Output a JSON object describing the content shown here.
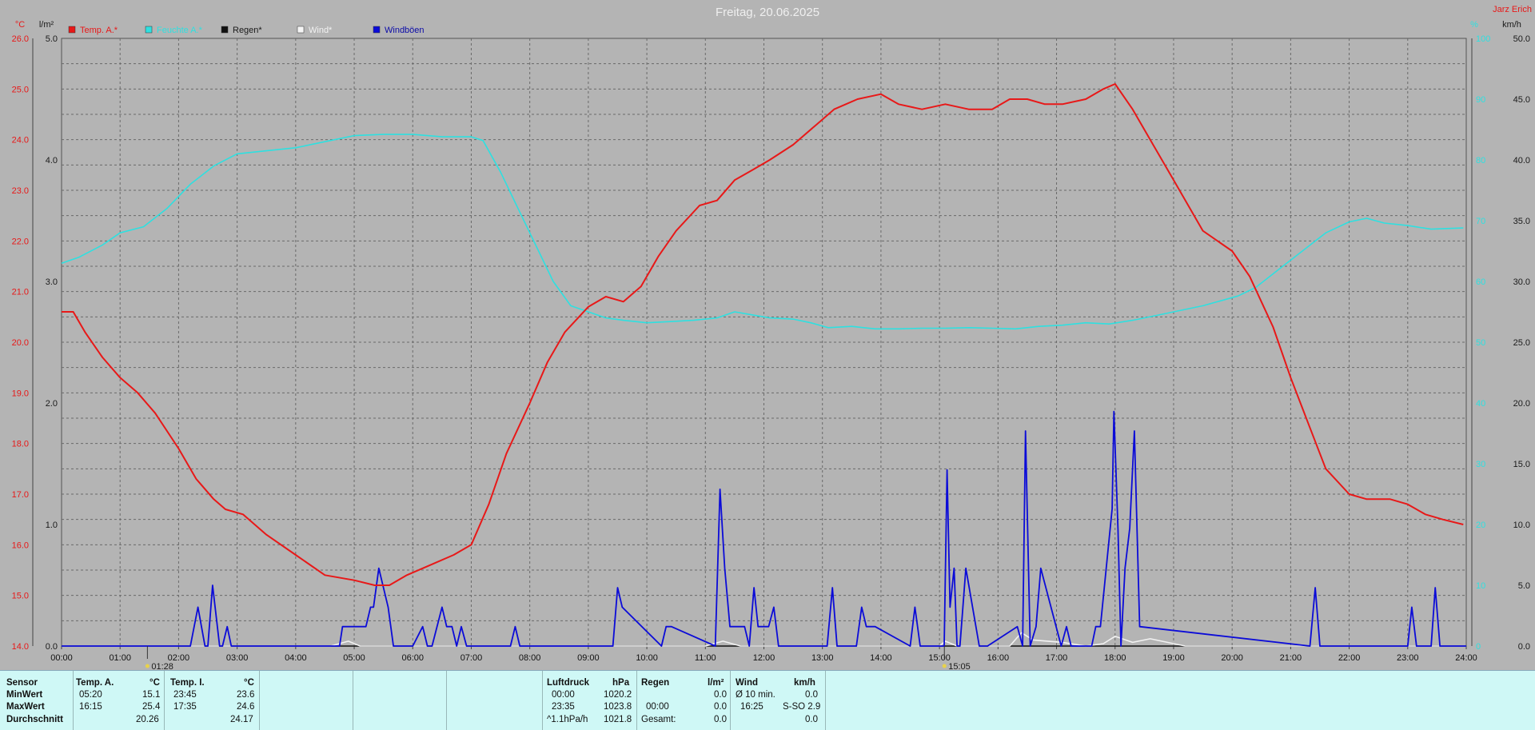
{
  "title": "Freitag, 20.06.2025",
  "station": "Jarz Erich",
  "units": {
    "temp": "°C",
    "rain": "l/m²",
    "hum": "%",
    "wind": "km/h"
  },
  "legend": [
    {
      "label": "Temp. A.*",
      "color": "#e81818"
    },
    {
      "label": "Feuchte A.*",
      "color": "#2ee0e0"
    },
    {
      "label": "Regen*",
      "color": "#111111"
    },
    {
      "label": "Wind*",
      "color": "#f5f5f5"
    },
    {
      "label": "Windböen",
      "color": "#0b0bd8"
    }
  ],
  "markers": [
    {
      "time": "01:28",
      "label": "01:28"
    },
    {
      "time": "15:05",
      "label": "15:05"
    }
  ],
  "chart_data": {
    "type": "line",
    "x_ticks": [
      "00:00",
      "01:00",
      "02:00",
      "03:00",
      "04:00",
      "05:00",
      "06:00",
      "07:00",
      "08:00",
      "09:00",
      "10:00",
      "11:00",
      "12:00",
      "13:00",
      "14:00",
      "15:00",
      "16:00",
      "17:00",
      "18:00",
      "19:00",
      "20:00",
      "21:00",
      "22:00",
      "23:00",
      "24:00"
    ],
    "axes": {
      "temp": {
        "ylim": [
          14.0,
          26.0
        ],
        "ticks": [
          "26.0",
          "25.0",
          "24.0",
          "23.0",
          "22.0",
          "21.0",
          "20.0",
          "19.0",
          "18.0",
          "17.0",
          "16.0",
          "15.0",
          "14.0"
        ]
      },
      "rain": {
        "ylim": [
          0.0,
          5.0
        ],
        "ticks": [
          "5.0",
          "4.0",
          "3.0",
          "2.0",
          "1.0",
          "0.0"
        ]
      },
      "hum": {
        "ylim": [
          0,
          100
        ],
        "ticks": [
          "100",
          "90",
          "80",
          "70",
          "60",
          "50",
          "40",
          "30",
          "20",
          "10",
          "0"
        ]
      },
      "wind": {
        "ylim": [
          0.0,
          50.0
        ],
        "ticks": [
          "50.0",
          "45.0",
          "40.0",
          "35.0",
          "30.0",
          "25.0",
          "20.0",
          "15.0",
          "10.0",
          "5.0",
          "0.0"
        ]
      }
    },
    "series": [
      {
        "name": "Temp. A.*",
        "axis": "temp",
        "color": "#e81818",
        "x": [
          0,
          0.2,
          0.4,
          0.7,
          1.0,
          1.3,
          1.6,
          2.0,
          2.3,
          2.6,
          2.8,
          3.1,
          3.5,
          4.0,
          4.5,
          5.0,
          5.35,
          5.6,
          5.9,
          6.3,
          6.7,
          7.0,
          7.3,
          7.6,
          8.0,
          8.3,
          8.6,
          9.0,
          9.3,
          9.6,
          9.9,
          10.2,
          10.5,
          10.9,
          11.2,
          11.5,
          11.8,
          12.1,
          12.5,
          12.9,
          13.2,
          13.6,
          14.0,
          14.3,
          14.7,
          15.1,
          15.5,
          15.9,
          16.2,
          16.5,
          16.8,
          17.1,
          17.5,
          17.8,
          18.0,
          18.3,
          18.6,
          19.0,
          19.5,
          20.0,
          20.3,
          20.7,
          21.0,
          21.3,
          21.6,
          22.0,
          22.3,
          22.7,
          23.0,
          23.3,
          23.6,
          23.95
        ],
        "y": [
          20.6,
          20.6,
          20.2,
          19.7,
          19.3,
          19.0,
          18.6,
          17.9,
          17.3,
          16.9,
          16.7,
          16.6,
          16.2,
          15.8,
          15.4,
          15.3,
          15.2,
          15.2,
          15.4,
          15.6,
          15.8,
          16.0,
          16.8,
          17.8,
          18.8,
          19.6,
          20.2,
          20.7,
          20.9,
          20.8,
          21.1,
          21.7,
          22.2,
          22.7,
          22.8,
          23.2,
          23.4,
          23.6,
          23.9,
          24.3,
          24.6,
          24.8,
          24.9,
          24.7,
          24.6,
          24.7,
          24.6,
          24.6,
          24.8,
          24.8,
          24.7,
          24.7,
          24.8,
          25.0,
          25.1,
          24.6,
          24.0,
          23.2,
          22.2,
          21.8,
          21.3,
          20.3,
          19.3,
          18.4,
          17.5,
          17.0,
          16.9,
          16.9,
          16.8,
          16.6,
          16.5,
          16.4
        ]
      },
      {
        "name": "Feuchte A.*",
        "axis": "hum",
        "color": "#2ee0e0",
        "x": [
          0,
          0.3,
          0.7,
          1.0,
          1.4,
          1.8,
          2.2,
          2.6,
          3.0,
          3.5,
          4.0,
          4.5,
          5.0,
          5.5,
          6.0,
          6.5,
          7.0,
          7.2,
          7.5,
          7.8,
          8.1,
          8.4,
          8.7,
          9.0,
          9.3,
          9.6,
          10.0,
          10.4,
          10.8,
          11.2,
          11.5,
          11.8,
          12.1,
          12.5,
          12.8,
          13.1,
          13.5,
          13.9,
          14.3,
          14.7,
          15.1,
          15.5,
          15.9,
          16.3,
          16.7,
          17.1,
          17.5,
          17.9,
          18.3,
          18.7,
          19.1,
          19.5,
          19.8,
          20.1,
          20.4,
          20.8,
          21.2,
          21.6,
          22.0,
          22.3,
          22.6,
          23.0,
          23.4,
          23.95
        ],
        "y": [
          63,
          64,
          66,
          68,
          69,
          72,
          76,
          79,
          81,
          81.5,
          82,
          83,
          84,
          84.2,
          84.2,
          83.8,
          83.8,
          83.2,
          78,
          72,
          66,
          60,
          56,
          55,
          54,
          53.6,
          53.2,
          53.4,
          53.6,
          54,
          55,
          54.5,
          54,
          53.8,
          53.2,
          52.4,
          52.6,
          52.2,
          52.2,
          52.3,
          52.3,
          52.4,
          52.3,
          52.2,
          52.6,
          52.8,
          53.2,
          53,
          53.6,
          54.4,
          55.2,
          56,
          56.8,
          57.6,
          59,
          62,
          65,
          68,
          69.8,
          70.4,
          69.6,
          69.2,
          68.6,
          68.8
        ]
      },
      {
        "name": "Wind*",
        "axis": "wind",
        "color": "#f2f2f2",
        "x": [
          0,
          4.6,
          4.9,
          5.1,
          11.0,
          11.3,
          11.6,
          15.0,
          15.1,
          15.3,
          16.2,
          16.4,
          16.6,
          17.1,
          17.5,
          17.8,
          18.0,
          18.3,
          18.6,
          19.0,
          19.2,
          24.0
        ],
        "y": [
          0,
          0,
          0.4,
          0,
          0,
          0.4,
          0,
          0,
          0.4,
          0,
          0,
          1.1,
          0.5,
          0.3,
          0,
          0.2,
          0.8,
          0.3,
          0.6,
          0.2,
          0,
          0
        ]
      },
      {
        "name": "Windböen",
        "axis": "wind",
        "color": "#0b0bd8",
        "x": [
          0,
          2.2,
          2.33,
          2.45,
          2.5,
          2.58,
          2.7,
          2.75,
          2.83,
          2.9,
          3.0,
          4.75,
          4.8,
          5.2,
          5.28,
          5.33,
          5.42,
          5.58,
          5.67,
          6.0,
          6.17,
          6.25,
          6.33,
          6.5,
          6.58,
          6.67,
          6.75,
          6.83,
          6.92,
          7.0,
          7.08,
          7.67,
          7.75,
          7.83,
          9.42,
          9.5,
          9.58,
          10.25,
          10.33,
          10.42,
          11.17,
          11.25,
          11.33,
          11.42,
          11.67,
          11.75,
          11.83,
          11.9,
          12.08,
          12.17,
          12.25,
          12.33,
          12.42,
          13.08,
          13.17,
          13.25,
          13.58,
          13.67,
          13.75,
          13.9,
          14.5,
          14.58,
          14.67,
          15.08,
          15.13,
          15.18,
          15.25,
          15.3,
          15.35,
          15.45,
          15.68,
          15.75,
          15.82,
          16.33,
          16.42,
          16.47,
          16.55,
          16.65,
          16.73,
          17.08,
          17.17,
          17.25,
          17.6,
          17.67,
          17.75,
          17.95,
          17.98,
          18.05,
          18.1,
          18.17,
          18.25,
          18.33,
          18.42,
          21.33,
          21.42,
          21.5,
          23.0,
          23.07,
          23.15,
          23.4,
          23.47,
          23.55,
          24.0
        ],
        "y": [
          0,
          0,
          3.2,
          0,
          0,
          5,
          0,
          0,
          1.6,
          0,
          0,
          0,
          1.6,
          1.6,
          3.2,
          3.2,
          6.4,
          3.2,
          0,
          0,
          1.6,
          0,
          0,
          3.2,
          1.6,
          1.6,
          0,
          1.6,
          0,
          0,
          0,
          0,
          1.6,
          0,
          0,
          4.8,
          3.2,
          0,
          1.6,
          1.6,
          0,
          12.9,
          6.4,
          1.6,
          1.6,
          0,
          4.8,
          1.6,
          1.6,
          3.2,
          0,
          0,
          0,
          0,
          4.8,
          0,
          0,
          3.2,
          1.6,
          1.6,
          0,
          3.2,
          0,
          0,
          14.5,
          3.2,
          6.4,
          0,
          0,
          6.4,
          0,
          0,
          0,
          1.6,
          0,
          17.7,
          0,
          1.6,
          6.4,
          0,
          1.6,
          0,
          0,
          1.6,
          1.6,
          11.3,
          19.3,
          9.6,
          0,
          6.4,
          9.7,
          17.7,
          1.6,
          0,
          4.8,
          0,
          0,
          3.2,
          0,
          0,
          4.8,
          0,
          0
        ]
      },
      {
        "name": "Regen*",
        "axis": "rain",
        "color": "#111111",
        "x": [
          0,
          24
        ],
        "y": [
          0,
          0
        ]
      }
    ]
  },
  "stats": {
    "sensor_header": "Sensor",
    "row_labels": [
      "MinWert",
      "MaxWert",
      "Durchschnitt"
    ],
    "temp_a": {
      "header": "Temp. A.",
      "unit": "°C",
      "min_time": "05:20",
      "min": "15.1",
      "max_time": "16:15",
      "max": "25.4",
      "avg": "20.26"
    },
    "temp_i": {
      "header": "Temp. I.",
      "unit": "°C",
      "min_time": "23:45",
      "min": "23.6",
      "max_time": "17:35",
      "max": "24.6",
      "avg": "24.17"
    },
    "luftdruck": {
      "header": "Luftdruck",
      "unit": "hPa",
      "min_time": "00:00",
      "min": "1020.2",
      "max_time": "23:35",
      "max": "1023.8",
      "trend_label": "^1.1hPa/h",
      "avg": "1021.8"
    },
    "regen": {
      "header": "Regen",
      "unit": "l/m²",
      "r1_val": "0.0",
      "r2_time": "00:00",
      "r2_val": "0.0",
      "total_label": "Gesamt:",
      "total": "0.0"
    },
    "wind": {
      "header": "Wind",
      "unit": "km/h",
      "r1_label": "Ø 10 min.",
      "r1_val": "0.0",
      "r2_time": "16:25",
      "r2_val": "S-SO 2.9",
      "r3_val": "0.0"
    }
  }
}
